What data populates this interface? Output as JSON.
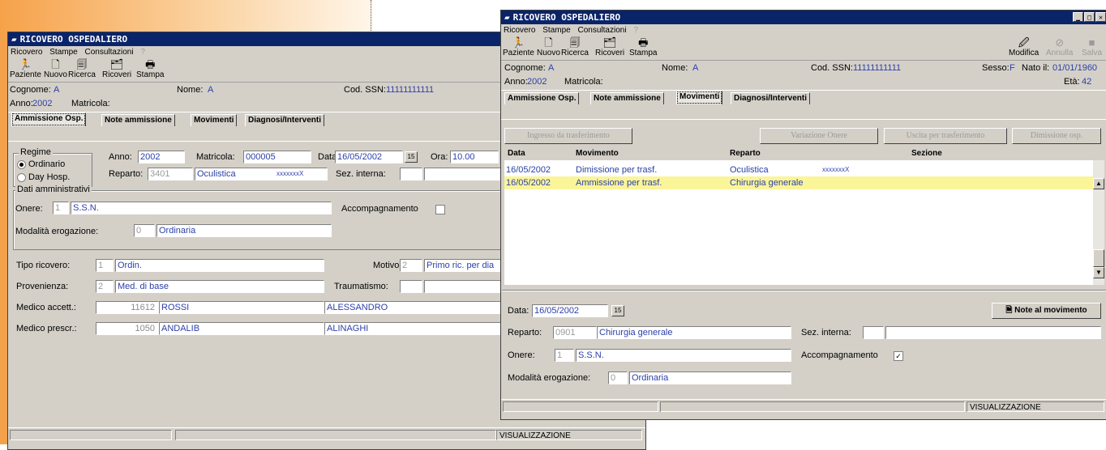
{
  "back": {
    "title": "RICOVERO OSPEDALIERO",
    "menu": [
      "Ricovero",
      "Stampe",
      "Consultazioni",
      "?"
    ],
    "toolbar": [
      "Paziente",
      "Nuovo",
      "Ricerca",
      "Ricoveri",
      "Stampa"
    ],
    "info": {
      "cognome_label": "Cognome:",
      "cognome": "A",
      "nome_label": "Nome:",
      "nome": "A",
      "ssn_label": "Cod. SSN:",
      "ssn": "11111111111",
      "anno_label": "Anno:",
      "anno": "2002",
      "matricola_label": "Matricola:"
    },
    "tabs": [
      "Ammissione Osp.",
      "Note ammissione",
      "Movimenti",
      "Diagnosi/Interventi"
    ],
    "regime": {
      "legend": "Regime",
      "ordinario": "Ordinario",
      "dayhosp": "Day Hosp."
    },
    "anno_label": "Anno:",
    "anno_value": "2002",
    "matricola_label": "Matricola:",
    "matricola_value": "000005",
    "data_label": "Data:",
    "data_value": "16/05/2002",
    "ora_label": "Ora:",
    "ora_value": "10.00",
    "reparto_label": "Reparto:",
    "reparto_code": "3401",
    "reparto_name": "Oculistica",
    "reparto_extra": "xxxxxxxX",
    "sez_label": "Sez. interna:",
    "dati": {
      "legend": "Dati amministrativi",
      "onere_label": "Onere:",
      "onere_code": "1",
      "onere_value": "S.S.N.",
      "accomp_label": "Accompagnamento",
      "mod_label": "Modalità erogazione:",
      "mod_code": "0",
      "mod_value": "Ordinaria"
    },
    "tipo_label": "Tipo ricovero:",
    "tipo_code": "1",
    "tipo_value": "Ordin.",
    "motivo_label": "Motivo:",
    "motivo_code": "2",
    "motivo_value": "Primo ric. per dia",
    "prov_label": "Provenienza:",
    "prov_code": "2",
    "prov_value": "Med. di base",
    "trauma_label": "Traumatismo:",
    "medacc_label": "Medico accett.:",
    "medacc_code": "11612",
    "medacc_surname": "ROSSI",
    "medacc_name": "ALESSANDRO",
    "medpres_label": "Medico prescr.:",
    "medpres_code": "1050",
    "medpres_surname": "ANDALIB",
    "medpres_name": "ALINAGHI",
    "status": "VISUALIZZAZIONE"
  },
  "front": {
    "title": "RICOVERO OSPEDALIERO",
    "menu": [
      "Ricovero",
      "Stampe",
      "Consultazioni",
      "?"
    ],
    "toolbar": [
      "Paziente",
      "Nuovo",
      "Ricerca",
      "Ricoveri",
      "Stampa"
    ],
    "toolbar_right": [
      "Modifica",
      "Annulla",
      "Salva"
    ],
    "info": {
      "cognome_label": "Cognome:",
      "cognome": "A",
      "nome_label": "Nome:",
      "nome": "A",
      "ssn_label": "Cod. SSN:",
      "ssn": "11111111111",
      "sesso_label": "Sesso:",
      "sesso": "F",
      "nato_label": "Nato il:",
      "nato": "01/01/1960",
      "eta_label": "Età:",
      "eta": "42",
      "anno_label": "Anno:",
      "anno": "2002",
      "matricola_label": "Matricola:"
    },
    "tabs": [
      "Ammissione Osp.",
      "Note ammissione",
      "Movimenti",
      "Diagnosi/Interventi"
    ],
    "actions": [
      "Ingresso da trasferimento",
      "Variazione Onere",
      "Uscita per trasferimento",
      "Dimissione osp."
    ],
    "columns": [
      "Data",
      "Movimento",
      "Reparto",
      "Sezione"
    ],
    "rows": [
      {
        "data": "16/05/2002",
        "movimento": "Dimissione per trasf.",
        "reparto": "Oculistica",
        "extra": "xxxxxxxX",
        "sezione": ""
      },
      {
        "data": "16/05/2002",
        "movimento": "Ammissione per trasf.",
        "reparto": "Chirurgia generale",
        "extra": "",
        "sezione": ""
      }
    ],
    "detail": {
      "data_label": "Data:",
      "data_value": "16/05/2002",
      "note_button": "Note al movimento",
      "reparto_label": "Reparto:",
      "reparto_code": "0901",
      "reparto_name": "Chirurgia generale",
      "sez_label": "Sez. interna:",
      "onere_label": "Onere:",
      "onere_code": "1",
      "onere_value": "S.S.N.",
      "accomp_label": "Accompagnamento",
      "mod_label": "Modalità erogazione:",
      "mod_code": "0",
      "mod_value": "Ordinaria"
    },
    "status": "VISUALIZZAZIONE"
  }
}
